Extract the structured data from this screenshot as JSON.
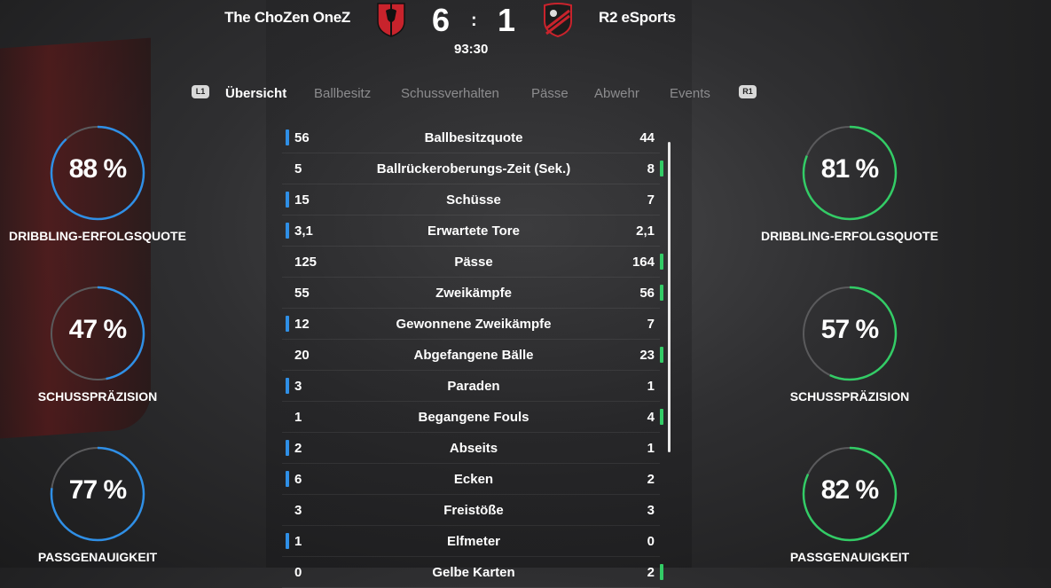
{
  "match": {
    "home_team": "The ChoZen OneZ",
    "away_team": "R2 eSports",
    "home_score": "6",
    "away_score": "1",
    "score_separator": ":",
    "clock": "93:30"
  },
  "tabs": {
    "left_button": "L1",
    "right_button": "R1",
    "items": [
      {
        "label": "Übersicht",
        "active": true
      },
      {
        "label": "Ballbesitz",
        "active": false
      },
      {
        "label": "Schussverhalten",
        "active": false
      },
      {
        "label": "Pässe",
        "active": false
      },
      {
        "label": "Abwehr",
        "active": false
      },
      {
        "label": "Events",
        "active": false
      }
    ]
  },
  "stats": [
    {
      "label": "Ballbesitzquote",
      "home": "56",
      "away": "44",
      "leader": "home"
    },
    {
      "label": "Ballrückeroberungs-Zeit (Sek.)",
      "home": "5",
      "away": "8",
      "leader": "away"
    },
    {
      "label": "Schüsse",
      "home": "15",
      "away": "7",
      "leader": "home"
    },
    {
      "label": "Erwartete Tore",
      "home": "3,1",
      "away": "2,1",
      "leader": "home"
    },
    {
      "label": "Pässe",
      "home": "125",
      "away": "164",
      "leader": "away"
    },
    {
      "label": "Zweikämpfe",
      "home": "55",
      "away": "56",
      "leader": "away"
    },
    {
      "label": "Gewonnene Zweikämpfe",
      "home": "12",
      "away": "7",
      "leader": "home"
    },
    {
      "label": "Abgefangene Bälle",
      "home": "20",
      "away": "23",
      "leader": "away"
    },
    {
      "label": "Paraden",
      "home": "3",
      "away": "1",
      "leader": "home"
    },
    {
      "label": "Begangene Fouls",
      "home": "1",
      "away": "4",
      "leader": "away"
    },
    {
      "label": "Abseits",
      "home": "2",
      "away": "1",
      "leader": "home"
    },
    {
      "label": "Ecken",
      "home": "6",
      "away": "2",
      "leader": "home"
    },
    {
      "label": "Freistöße",
      "home": "3",
      "away": "3",
      "leader": "none"
    },
    {
      "label": "Elfmeter",
      "home": "1",
      "away": "0",
      "leader": "home"
    },
    {
      "label": "Gelbe Karten",
      "home": "0",
      "away": "2",
      "leader": "away"
    }
  ],
  "home_rings": [
    {
      "value": "88 %",
      "fraction": 0.88,
      "label": "DRIBBLING-ERFOLGSQUOTE"
    },
    {
      "value": "47 %",
      "fraction": 0.47,
      "label": "SCHUSSPRÄZISION"
    },
    {
      "value": "77 %",
      "fraction": 0.77,
      "label": "PASSGENAUIGKEIT"
    }
  ],
  "away_rings": [
    {
      "value": "81 %",
      "fraction": 0.81,
      "label": "DRIBBLING-ERFOLGSQUOTE"
    },
    {
      "value": "57 %",
      "fraction": 0.57,
      "label": "SCHUSSPRÄZISION"
    },
    {
      "value": "82 %",
      "fraction": 0.82,
      "label": "PASSGENAUIGKEIT"
    }
  ],
  "colors": {
    "home_accent": "#2f8fe6",
    "away_accent": "#33cc66",
    "ring_track": "#5a5a5c"
  },
  "icons": {
    "home_crest": "home-team-crest-icon",
    "away_crest": "away-team-crest-icon"
  }
}
